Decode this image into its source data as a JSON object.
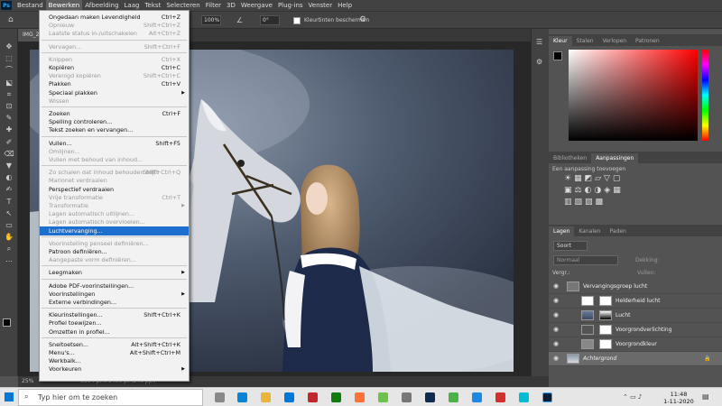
{
  "menubar": [
    "Bestand",
    "Bewerken",
    "Afbeelding",
    "Laag",
    "Tekst",
    "Selecteren",
    "Filter",
    "3D",
    "Weergave",
    "Plug-ins",
    "Venster",
    "Help"
  ],
  "options": {
    "zoom_value": "100%",
    "angle_value": "0°",
    "sample_all_label": "Kleurtinten beschermen"
  },
  "doc_tab": "IMG_2",
  "status": {
    "zoom": "25%",
    "info": "3504 pt x 3400 pt (240 ppi)"
  },
  "edit_menu": [
    {
      "label": "Ongedaan maken Levendigheid",
      "sc": "Ctrl+Z",
      "dis": false
    },
    {
      "label": "Opnieuw",
      "sc": "Shift+Ctrl+Z",
      "dis": true
    },
    {
      "label": "Laatste status in-/uitschakelen",
      "sc": "Alt+Ctrl+Z",
      "dis": true
    },
    {
      "sep": true
    },
    {
      "label": "Vervagen...",
      "sc": "Shift+Ctrl+F",
      "dis": true
    },
    {
      "sep": true
    },
    {
      "label": "Knippen",
      "sc": "Ctrl+X",
      "dis": true
    },
    {
      "label": "Kopiëren",
      "sc": "Ctrl+C",
      "dis": false
    },
    {
      "label": "Verenigd kopiëren",
      "sc": "Shift+Ctrl+C",
      "dis": true
    },
    {
      "label": "Plakken",
      "sc": "Ctrl+V",
      "dis": false
    },
    {
      "label": "Speciaal plakken",
      "sc": "",
      "dis": false,
      "sub": true
    },
    {
      "label": "Wissen",
      "sc": "",
      "dis": true
    },
    {
      "sep": true
    },
    {
      "label": "Zoeken",
      "sc": "Ctrl+F",
      "dis": false
    },
    {
      "label": "Spelling controleren...",
      "sc": "",
      "dis": false
    },
    {
      "label": "Tekst zoeken en vervangen...",
      "sc": "",
      "dis": false
    },
    {
      "sep": true
    },
    {
      "label": "Vullen...",
      "sc": "Shift+F5",
      "dis": false
    },
    {
      "label": "Omlijnen...",
      "sc": "",
      "dis": true
    },
    {
      "label": "Vullen met behoud van inhoud...",
      "sc": "",
      "dis": true
    },
    {
      "sep": true
    },
    {
      "label": "Zo schalen dat inhoud behouden blijft",
      "sc": "Shift+Ctrl+Q",
      "dis": true
    },
    {
      "label": "Marionet verdraaien",
      "sc": "",
      "dis": true
    },
    {
      "label": "Perspectief verdraaien",
      "sc": "",
      "dis": false
    },
    {
      "label": "Vrije transformatie",
      "sc": "Ctrl+T",
      "dis": true
    },
    {
      "label": "Transformatie",
      "sc": "",
      "dis": true,
      "sub": true
    },
    {
      "label": "Lagen automatisch uitlijnen...",
      "sc": "",
      "dis": true
    },
    {
      "label": "Lagen automatisch overvloeien...",
      "sc": "",
      "dis": true
    },
    {
      "label": "Luchtvervanging...",
      "sc": "",
      "dis": false,
      "hl": true
    },
    {
      "sep": true
    },
    {
      "label": "Voorinstelling penseel definiëren...",
      "sc": "",
      "dis": true
    },
    {
      "label": "Patroon definiëren...",
      "sc": "",
      "dis": false
    },
    {
      "label": "Aangepaste vorm definiëren...",
      "sc": "",
      "dis": true
    },
    {
      "sep": true
    },
    {
      "label": "Leegmaken",
      "sc": "",
      "dis": false,
      "sub": true
    },
    {
      "sep": true
    },
    {
      "label": "Adobe PDF-voorinstellingen...",
      "sc": "",
      "dis": false
    },
    {
      "label": "Voorinstellingen",
      "sc": "",
      "dis": false,
      "sub": true
    },
    {
      "label": "Externe verbindingen...",
      "sc": "",
      "dis": false
    },
    {
      "sep": true
    },
    {
      "label": "Kleurinstellingen...",
      "sc": "Shift+Ctrl+K",
      "dis": false
    },
    {
      "label": "Profiel toewijzen...",
      "sc": "",
      "dis": false
    },
    {
      "label": "Omzetten in profiel...",
      "sc": "",
      "dis": false
    },
    {
      "sep": true
    },
    {
      "label": "Sneltoetsen...",
      "sc": "Alt+Shift+Ctrl+K",
      "dis": false
    },
    {
      "label": "Menu's...",
      "sc": "Alt+Shift+Ctrl+M",
      "dis": false
    },
    {
      "label": "Werkbalk...",
      "sc": "",
      "dis": false
    },
    {
      "label": "Voorkeuren",
      "sc": "",
      "dis": false,
      "sub": true
    }
  ],
  "panels": {
    "color_tabs": [
      "Kleur",
      "Stalen",
      "Verlopen",
      "Patronen"
    ],
    "adj_tabs": [
      "Bibliotheken",
      "Aanpassingen"
    ],
    "adj_hint": "Een aanpassing toevoegen",
    "layer_tabs": [
      "Lagen",
      "Kanalen",
      "Paden"
    ],
    "kind_label": "Soort",
    "blend_mode": "Normaal",
    "opacity_label": "Dekking:",
    "lock_label": "Vergr.:",
    "fill_label": "Vullen:",
    "layers": [
      "Vervangingsgroep lucht",
      "Helderheid lucht",
      "Lucht",
      "Voorgrondverlichting",
      "Voorgrondkleur",
      "Achtergrond"
    ]
  },
  "taskbar": {
    "search": "Typ hier om te zoeken",
    "time": "11:48",
    "date": "1-11-2020"
  }
}
